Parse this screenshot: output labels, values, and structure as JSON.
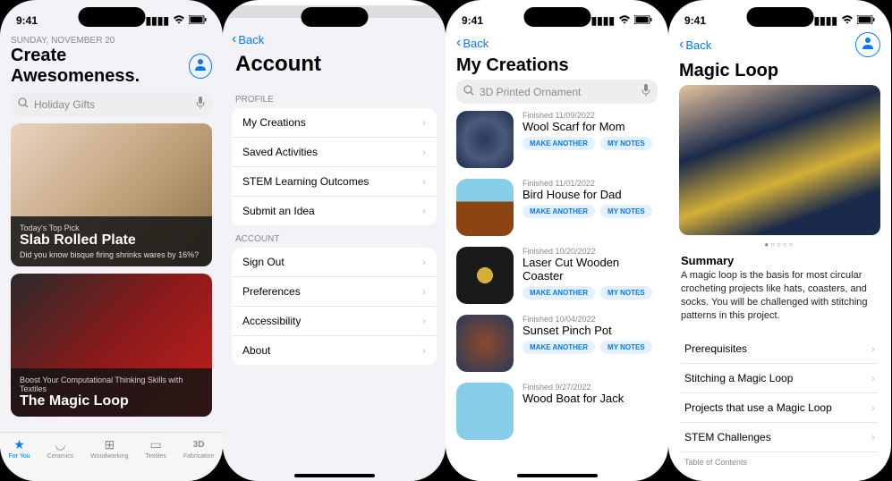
{
  "status": {
    "time": "9:41"
  },
  "screen1": {
    "date": "Sunday, November 20",
    "title": "Create Awesomeness.",
    "search_placeholder": "Holiday Gifts",
    "cards": [
      {
        "eyebrow": "Today's Top Pick",
        "title": "Slab Rolled Plate",
        "sub": "Did you know bisque firing shrinks wares by 16%?"
      },
      {
        "eyebrow": "Boost Your Computational Thinking Skills with Textiles",
        "title": "The Magic Loop",
        "sub": ""
      }
    ],
    "tabs": [
      {
        "label": "For You",
        "icon": "★"
      },
      {
        "label": "Ceramics",
        "icon": "◡"
      },
      {
        "label": "Woodworking",
        "icon": "⊞"
      },
      {
        "label": "Textiles",
        "icon": "▭"
      },
      {
        "label": "Fabrication",
        "icon": "3D"
      }
    ]
  },
  "screen2": {
    "back": "Back",
    "title": "Account",
    "section1_label": "PROFILE",
    "section1": [
      "My Creations",
      "Saved Activities",
      "STEM Learning Outcomes",
      "Submit an Idea"
    ],
    "section2_label": "ACCOUNT",
    "section2": [
      "Sign Out",
      "Preferences",
      "Accessibility",
      "About"
    ]
  },
  "screen3": {
    "back": "Back",
    "title": "My Creations",
    "search_placeholder": "3D Printed Ornament",
    "make_another": "MAKE ANOTHER",
    "my_notes": "MY NOTES",
    "items": [
      {
        "finished": "Finished 11/09/2022",
        "name": "Wool Scarf for Mom"
      },
      {
        "finished": "Finished 11/01/2022",
        "name": "Bird House for Dad"
      },
      {
        "finished": "Finished 10/20/2022",
        "name": "Laser Cut Wooden Coaster"
      },
      {
        "finished": "Finished 10/04/2022",
        "name": "Sunset Pinch Pot"
      },
      {
        "finished": "Finished 9/27/2022",
        "name": "Wood Boat for Jack"
      }
    ]
  },
  "screen4": {
    "back": "Back",
    "title": "Magic Loop",
    "page_dots": "●○○○○",
    "summary_heading": "Summary",
    "summary_text": "A magic loop is the basis for most circular crocheting projects like hats, coasters, and socks. You will be challenged with stitching patterns in this project.",
    "toc": [
      "Prerequisites",
      "Stitching a Magic Loop",
      "Projects that use a Magic Loop",
      "STEM Challenges"
    ],
    "toc_label": "Table of Contents"
  }
}
